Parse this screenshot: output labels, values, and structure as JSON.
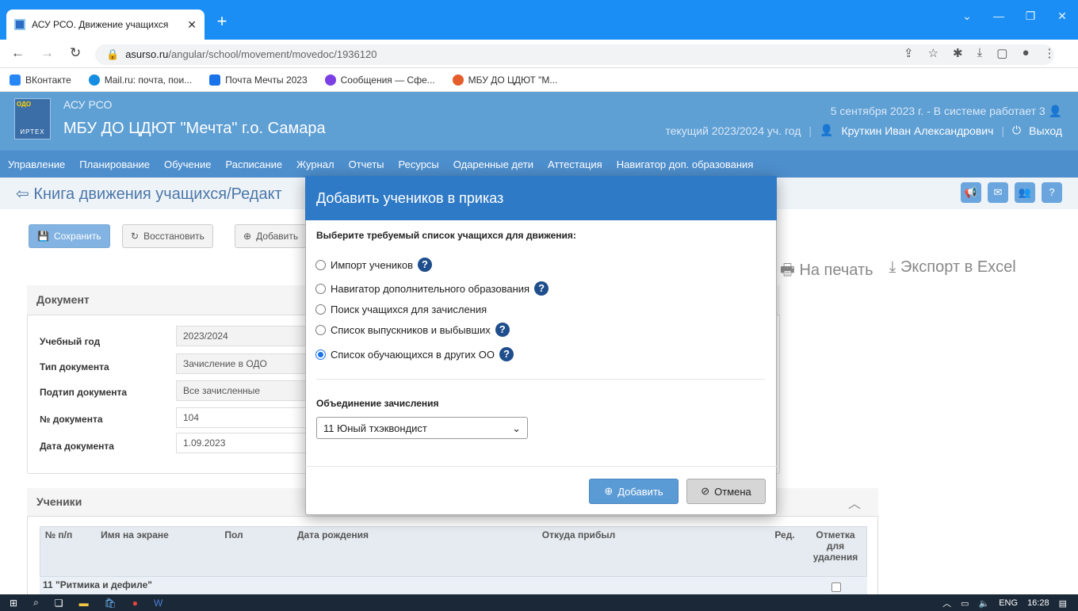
{
  "browser": {
    "tab_title": "АСУ РСО. Движение учащихся",
    "url_host": "asurso.ru",
    "url_path": "/angular/school/movement/movedoc/1936120",
    "bookmarks": [
      {
        "label": "ВКонтакте",
        "color": "#2787f5"
      },
      {
        "label": "Mail.ru: почта, пои...",
        "color": "#168de2"
      },
      {
        "label": "Почта Мечты 2023",
        "color": "#1a73e8"
      },
      {
        "label": "Сообщения — Сфе...",
        "color": "#7b3fe4"
      },
      {
        "label": "МБУ ДО ЦДЮТ \"М...",
        "color": "#e55d2b"
      }
    ]
  },
  "app": {
    "logo_top": "ОДО",
    "logo_bottom": "ИРТЕХ",
    "name": "АСУ РСО",
    "org": "МБУ ДО ЦДЮТ \"Мечта\" г.о. Самара",
    "status": "5 сентября 2023 г. - В системе работает 3",
    "year": "текущий 2023/2024 уч. год",
    "user": "Круткин Иван Александрович",
    "logout": "Выход",
    "menu": [
      "Управление",
      "Планирование",
      "Обучение",
      "Расписание",
      "Журнал",
      "Отчеты",
      "Ресурсы",
      "Одаренные дети",
      "Аттестация",
      "Навигатор доп. образования"
    ]
  },
  "page": {
    "title": "Книга движения учащихся/Редакт",
    "save": "Сохранить",
    "restore": "Восстановить",
    "add": "Добавить",
    "print": "На печать",
    "export": "Экспорт в Excel",
    "doc_header": "Документ",
    "fields": [
      {
        "label": "Учебный год",
        "value": "2023/2024"
      },
      {
        "label": "Тип документа",
        "value": "Зачисление в ОДО"
      },
      {
        "label": "Подтип документа",
        "value": "Все зачисленные"
      },
      {
        "label": "№ документа",
        "value": "104"
      },
      {
        "label": "Дата документа",
        "value": "1.09.2023"
      }
    ],
    "students_header": "Ученики",
    "columns": [
      "№ п/п",
      "Имя на экране",
      "Пол",
      "Дата рождения",
      "Откуда прибыл",
      "Ред.",
      "Отметка для удаления"
    ],
    "group_row": "11 \"Ритмика и дефиле\""
  },
  "modal": {
    "title": "Добавить учеников в приказ",
    "question": "Выберите требуемый список учащихся для движения:",
    "options": [
      {
        "label": "Импорт учеников",
        "help": true
      },
      {
        "label": "Навигатор дополнительного образования",
        "help": true
      },
      {
        "label": "Поиск учащихся для зачисления",
        "help": false
      },
      {
        "label": "Список выпускников и выбывших",
        "help": true
      },
      {
        "label": "Список обучающихся в других ОО",
        "help": true
      }
    ],
    "selected_option_index": 4,
    "union_label": "Объединение зачисления",
    "union_value": "11 Юный тхэквондист",
    "add_btn": "Добавить",
    "cancel_btn": "Отмена"
  },
  "taskbar": {
    "lang": "ENG",
    "time": "16:28"
  }
}
